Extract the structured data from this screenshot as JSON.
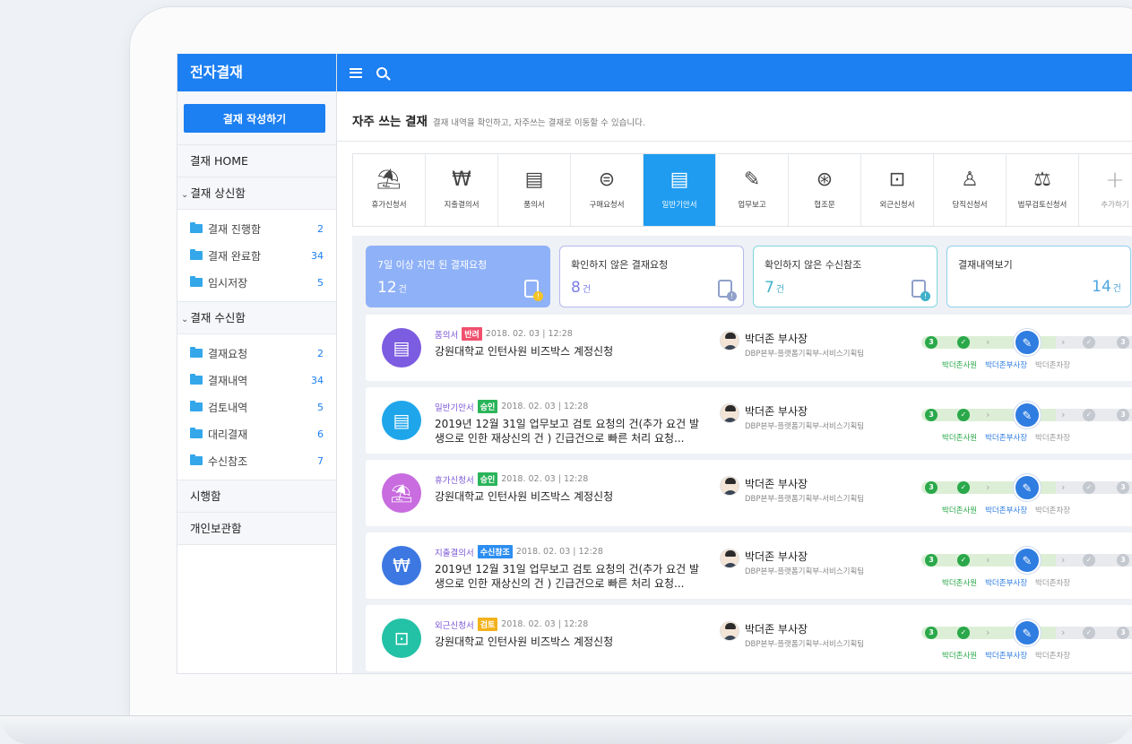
{
  "sidebar": {
    "brand": "전자결재",
    "compose_label": "결재 작성하기",
    "home": "결재 HOME",
    "section_send": "결재 상신함",
    "send_items": [
      {
        "label": "결재 진행함",
        "count": "2"
      },
      {
        "label": "결재 완료함",
        "count": "34"
      },
      {
        "label": "임시저장",
        "count": "5"
      }
    ],
    "section_receive": "결재 수신함",
    "receive_items": [
      {
        "label": "결재요청",
        "count": "2"
      },
      {
        "label": "결재내역",
        "count": "34"
      },
      {
        "label": "검토내역",
        "count": "5"
      },
      {
        "label": "대리결재",
        "count": "6"
      },
      {
        "label": "수신참조",
        "count": "7"
      }
    ],
    "section_exec": "시행함",
    "section_personal": "개인보관함"
  },
  "header": {
    "title": "자주 쓰는 결재",
    "desc": "결재 내역을 확인하고, 자주쓰는 결재로 이동할 수 있습니다."
  },
  "forms": [
    {
      "label": "휴가신청서",
      "icon": "vacation-icon"
    },
    {
      "label": "지출결의서",
      "icon": "expense-icon"
    },
    {
      "label": "품의서",
      "icon": "proposal-icon"
    },
    {
      "label": "구매요청서",
      "icon": "purchase-icon"
    },
    {
      "label": "일반기안서",
      "icon": "draft-icon",
      "active": true
    },
    {
      "label": "업무보고",
      "icon": "report-icon"
    },
    {
      "label": "협조문",
      "icon": "cooperation-icon"
    },
    {
      "label": "외근신청서",
      "icon": "briefcase-icon"
    },
    {
      "label": "당직신청서",
      "icon": "duty-icon"
    },
    {
      "label": "법무검토신청서",
      "icon": "legal-icon"
    },
    {
      "label": "추가하기",
      "icon": "plus-icon"
    }
  ],
  "stats": [
    {
      "title": "7일 이상 지연 된 결재요청",
      "num": "12",
      "unit": "건"
    },
    {
      "title": "확인하지 않은 결재요청",
      "num": "8",
      "unit": "건"
    },
    {
      "title": "확인하지 않은 수신참조",
      "num": "7",
      "unit": "건"
    },
    {
      "title": "결재내역보기",
      "num": "14",
      "unit": "건"
    }
  ],
  "rows": [
    {
      "type": "품의서",
      "badge": "반려",
      "badge_color": "#f0506e",
      "date": "2018. 02. 03 | 12:28",
      "title": "강원대학교 인턴사원 비즈박스 계정신청",
      "icon_color": "#7c5ce0",
      "icon": "proposal-icon"
    },
    {
      "type": "일반기안서",
      "badge": "승인",
      "badge_color": "#2ab45a",
      "date": "2018. 02. 03 | 12:28",
      "title": "2019년 12월 31일 업무보고 검토 요청의 건(추가 요건 발생으로 인한 재상신의 건 ) 긴급건으로 빠른 처리 요청...",
      "icon_color": "#1fa6ea",
      "icon": "draft-icon"
    },
    {
      "type": "휴가신청서",
      "badge": "승인",
      "badge_color": "#2ab45a",
      "date": "2018. 02. 03 | 12:28",
      "title": "강원대학교 인턴사원 비즈박스 계정신청",
      "icon_color": "#c86cdf",
      "icon": "vacation-icon"
    },
    {
      "type": "지출결의서",
      "badge": "수신참조",
      "badge_color": "#2c8ef0",
      "date": "2018. 02. 03 | 12:28",
      "title": "2019년 12월 31일 업무보고 검토 요청의 건(추가 요건 발생으로 인한 재상신의 건 ) 긴급건으로 빠른 처리 요청...",
      "icon_color": "#3d78e2",
      "icon": "expense-icon"
    },
    {
      "type": "외근신청서",
      "badge": "검토",
      "badge_color": "#f2b21c",
      "date": "2018. 02. 03 | 12:28",
      "title": "강원대학교 인턴사원 비즈박스 계정신청",
      "icon_color": "#23c1a6",
      "icon": "briefcase-icon"
    }
  ],
  "approver": {
    "name": "박더존 부사장",
    "org": "DBP본부-플랫폼기획부-서비스기획팀"
  },
  "flow": {
    "step1": "박더존사원",
    "step2": "박더존부사장",
    "step3": "박더존차장",
    "n1": "3",
    "n3": "3"
  }
}
